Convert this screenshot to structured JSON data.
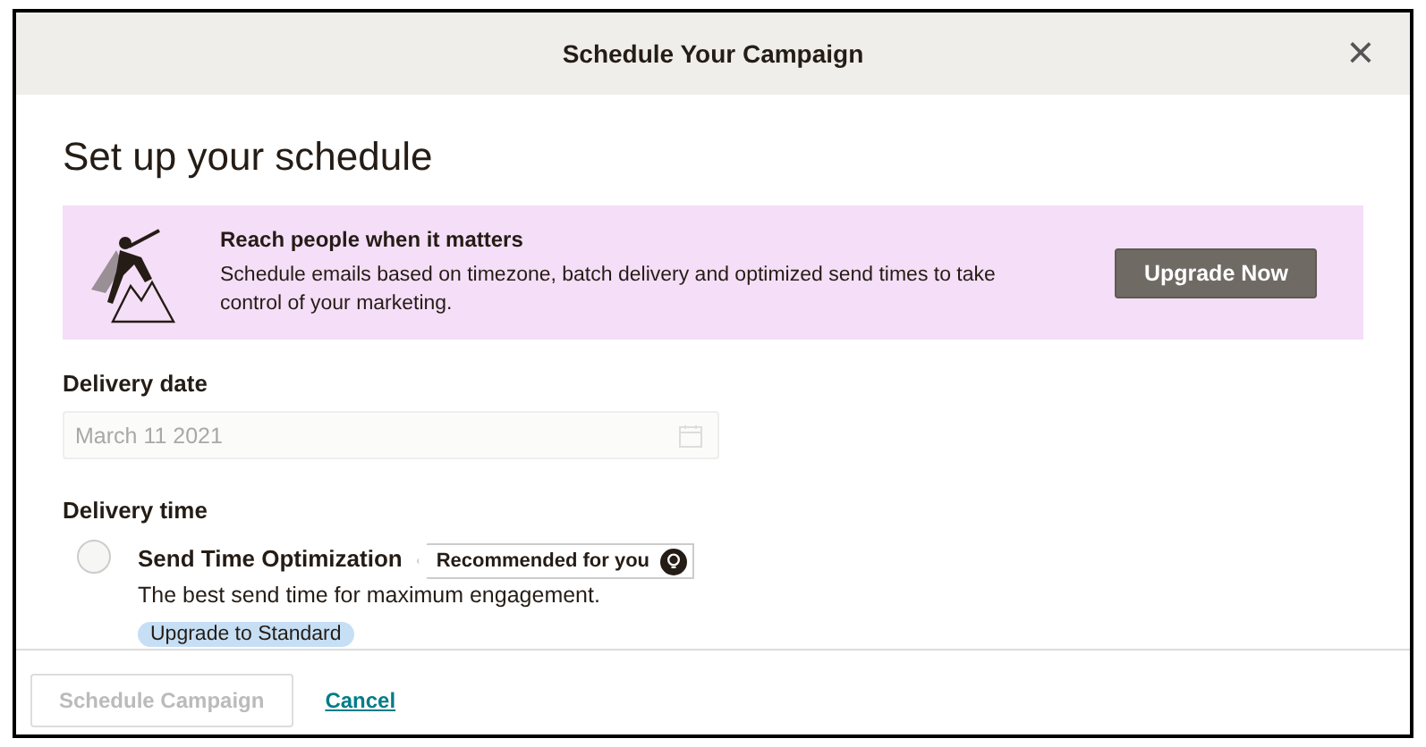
{
  "window": {
    "title": "Schedule Your Campaign",
    "close": "×"
  },
  "heading": "Set up your schedule",
  "banner": {
    "title": "Reach people when it matters",
    "text": "Schedule emails based on timezone, batch delivery and optimized send times to take control of your marketing.",
    "button": "Upgrade Now"
  },
  "delivery_date": {
    "label": "Delivery date",
    "value": "March 11 2021",
    "disabled": true
  },
  "delivery_time": {
    "label": "Delivery time",
    "options": [
      {
        "label": "Send Time Optimization",
        "description": "The best send time for maximum engagement.",
        "badge": "Upgrade to Standard",
        "tooltip": "Recommended for you",
        "selected": false
      }
    ]
  },
  "footer": {
    "buttons": [
      {
        "label": "Schedule Campaign",
        "kind": "button",
        "disabled": true
      },
      {
        "label": "Cancel",
        "kind": "link",
        "disabled": false
      }
    ]
  }
}
